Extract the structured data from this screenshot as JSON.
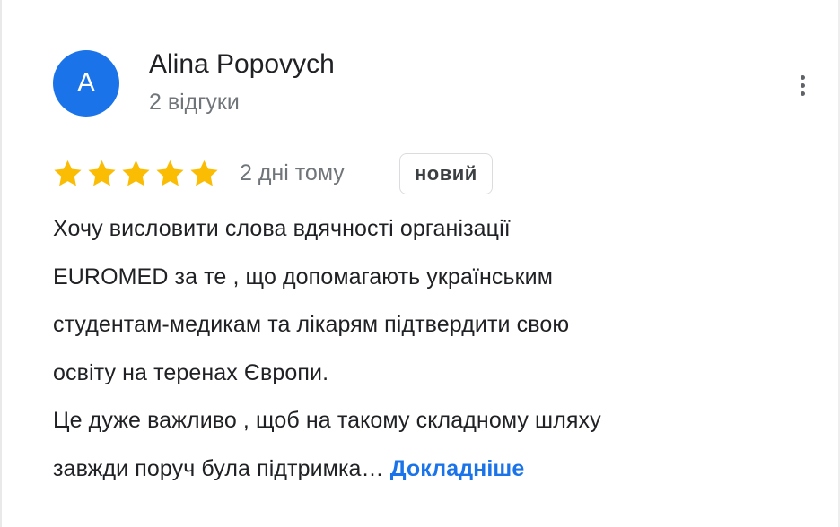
{
  "author": {
    "avatar_initial": "A",
    "avatar_color": "#1a73e8",
    "name": "Alina Popovych",
    "reviews_count": "2 відгуки"
  },
  "review": {
    "rating": 5,
    "rating_max": 5,
    "star_color": "#fbbc04",
    "date": "2 дні тому",
    "badge": "новий",
    "text_lines": [
      "Хочу висловити слова вдячності організації",
      "EUROMED за те , що допомагають українським",
      "студентам-медикам та лікарям підтвердити свою",
      "освіту на теренах Європи.",
      "Це дуже важливо , щоб на такому складному шляху",
      "завжди поруч була підтримка…"
    ],
    "more_label": "Докладніше"
  },
  "icons": {
    "more": "more-vert-icon",
    "star": "star-icon"
  }
}
